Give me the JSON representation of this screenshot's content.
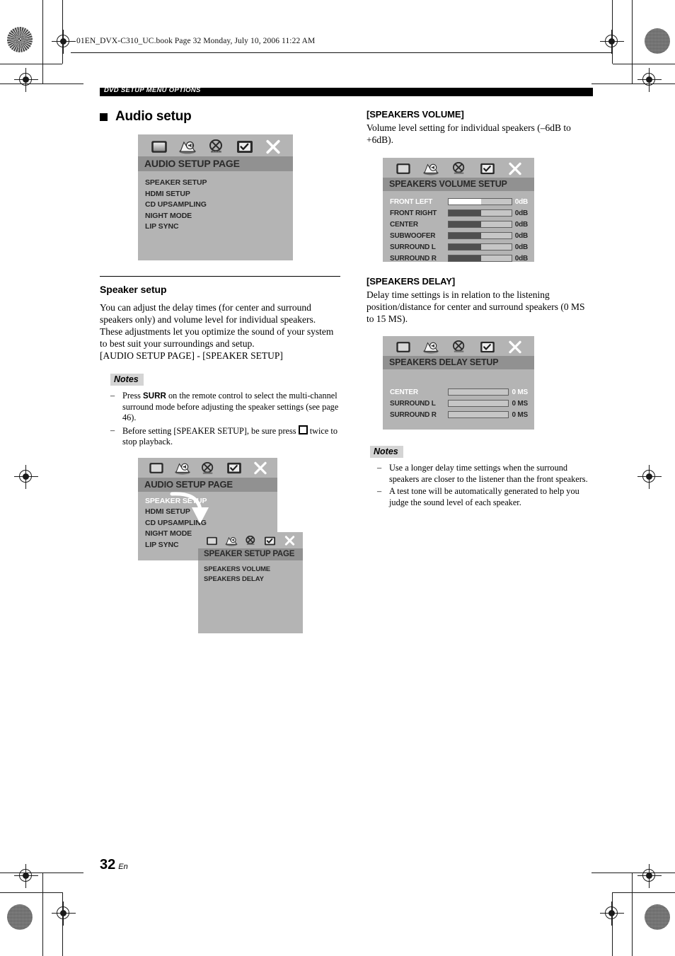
{
  "file_header": "01EN_DVX-C310_UC.book  Page 32  Monday, July 10, 2006  11:22 AM",
  "section_bar": "DVD SETUP MENU OPTIONS",
  "page_title": "Audio setup",
  "footer": {
    "number": "32",
    "lang": "En"
  },
  "colors": {
    "osd_bg": "#b4b4b4",
    "osd_titlebar": "#919191",
    "osd_highlight": "#ffffff",
    "bar_fill": "#4f4f4f",
    "bar_track": "#c6c6c6",
    "notes_label_bg": "#d4d4d4"
  },
  "icons": [
    "tv-screen-icon",
    "speaker-audio-icon",
    "video-disabled-icon",
    "preferences-check-icon",
    "close-x-icon"
  ],
  "osd_audio_setup": {
    "title": "AUDIO SETUP PAGE",
    "items": [
      {
        "label": "SPEAKER SETUP",
        "highlighted": false
      },
      {
        "label": "HDMI SETUP",
        "highlighted": false
      },
      {
        "label": "CD UPSAMPLING",
        "highlighted": false
      },
      {
        "label": "NIGHT MODE",
        "highlighted": false
      },
      {
        "label": "LIP SYNC",
        "highlighted": false
      }
    ]
  },
  "speaker_setup": {
    "heading": "Speaker setup",
    "body": "You can adjust the delay times (for center and surround speakers only) and volume level for individual speakers. These adjustments let you optimize the sound of your system to best suit your surroundings and setup.",
    "path": "[AUDIO SETUP PAGE] - [SPEAKER SETUP]",
    "notes_label": "Notes",
    "note1_a": "Press ",
    "note1_b": "SURR",
    "note1_c": " on the remote control to select the multi-channel surround mode before adjusting the speaker settings (see page 46).",
    "note2_a": "Before setting [SPEAKER SETUP], be sure press ",
    "note2_b": " twice to stop playback."
  },
  "osd_audio_setup_2": {
    "title": "AUDIO SETUP PAGE",
    "items": [
      {
        "label": "SPEAKER SETUP",
        "highlighted": true
      },
      {
        "label": "HDMI SETUP",
        "highlighted": false
      },
      {
        "label": "CD UPSAMPLING",
        "highlighted": false
      },
      {
        "label": "NIGHT MODE",
        "highlighted": false
      },
      {
        "label": "LIP SYNC",
        "highlighted": false
      }
    ]
  },
  "osd_speaker_setup_page": {
    "title": "SPEAKER SETUP PAGE",
    "items": [
      {
        "label": "SPEAKERS VOLUME",
        "highlighted": false
      },
      {
        "label": "SPEAKERS DELAY",
        "highlighted": false
      }
    ]
  },
  "speakers_volume": {
    "heading": "[SPEAKERS VOLUME]",
    "body": "Volume level setting for individual speakers (–6dB to +6dB).",
    "osd": {
      "title": "SPEAKERS VOLUME SETUP",
      "rows": [
        {
          "label": "FRONT LEFT",
          "value": "0dB",
          "fill": 52,
          "highlighted": true
        },
        {
          "label": "FRONT RIGHT",
          "value": "0dB",
          "fill": 52,
          "highlighted": false
        },
        {
          "label": "CENTER",
          "value": "0dB",
          "fill": 52,
          "highlighted": false
        },
        {
          "label": "SUBWOOFER",
          "value": "0dB",
          "fill": 52,
          "highlighted": false
        },
        {
          "label": "SURROUND L",
          "value": "0dB",
          "fill": 52,
          "highlighted": false
        },
        {
          "label": "SURROUND R",
          "value": "0dB",
          "fill": 52,
          "highlighted": false
        }
      ]
    }
  },
  "speakers_delay": {
    "heading": "[SPEAKERS DELAY]",
    "body": "Delay time settings is in relation to the listening position/distance for center and surround speakers (0 MS to 15 MS).",
    "osd": {
      "title": "SPEAKERS DELAY SETUP",
      "rows": [
        {
          "label": "CENTER",
          "value": "0 MS",
          "fill": 0,
          "highlighted": true
        },
        {
          "label": "SURROUND L",
          "value": "0 MS",
          "fill": 0,
          "highlighted": false
        },
        {
          "label": "SURROUND R",
          "value": "0 MS",
          "fill": 0,
          "highlighted": false
        }
      ]
    },
    "notes_label": "Notes",
    "note1": "Use a longer delay time settings when the surround speakers are closer to the listener than the front speakers.",
    "note2": "A test tone will be automatically generated to help you judge the sound level of each speaker."
  }
}
